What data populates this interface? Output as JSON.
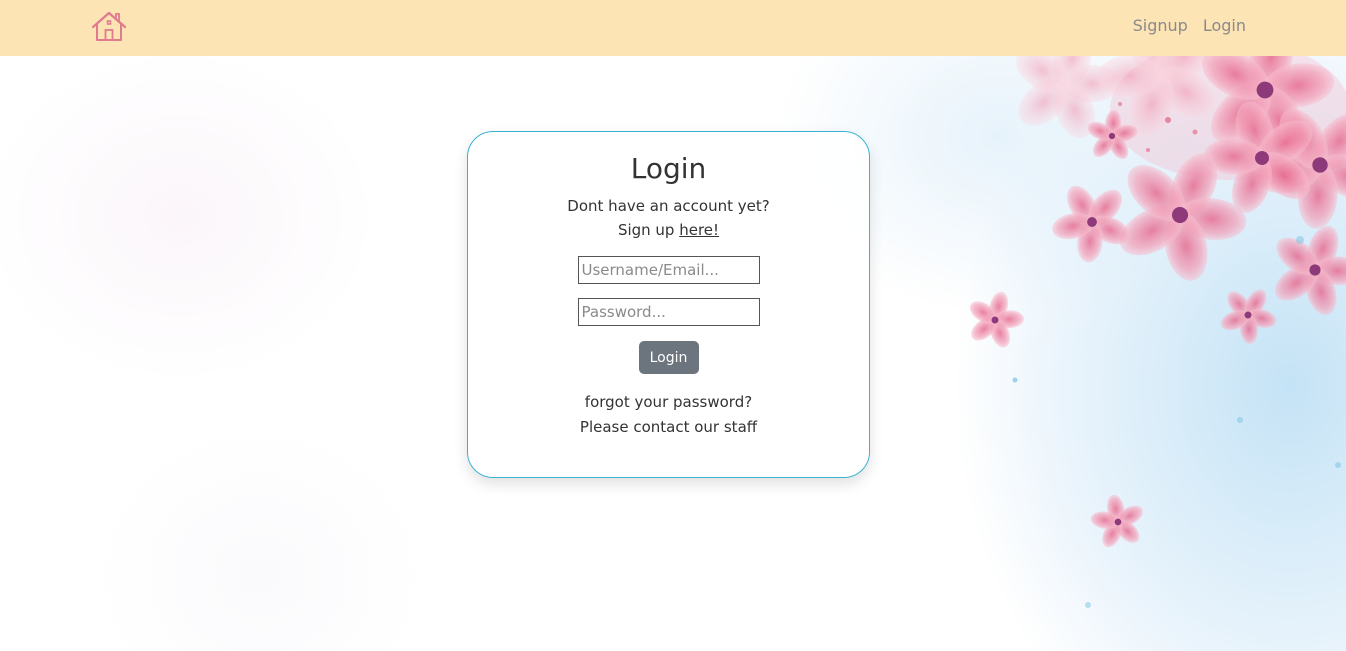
{
  "navbar": {
    "home_icon": "house-icon",
    "links": [
      {
        "label": "Signup"
      },
      {
        "label": "Login"
      }
    ],
    "background": "#fde4b4"
  },
  "login_card": {
    "title": "Login",
    "prompt_line1": "Dont have an account yet?",
    "prompt_line2_prefix": "Sign up",
    "prompt_link": "here!",
    "username_placeholder": "Username/Email...",
    "password_placeholder": "Password...",
    "submit_label": "Login",
    "forgot_line1": "forgot your password?",
    "forgot_line2": "Please contact our staff",
    "border_color": "#3bb1d0",
    "button_color": "#6c747e"
  }
}
